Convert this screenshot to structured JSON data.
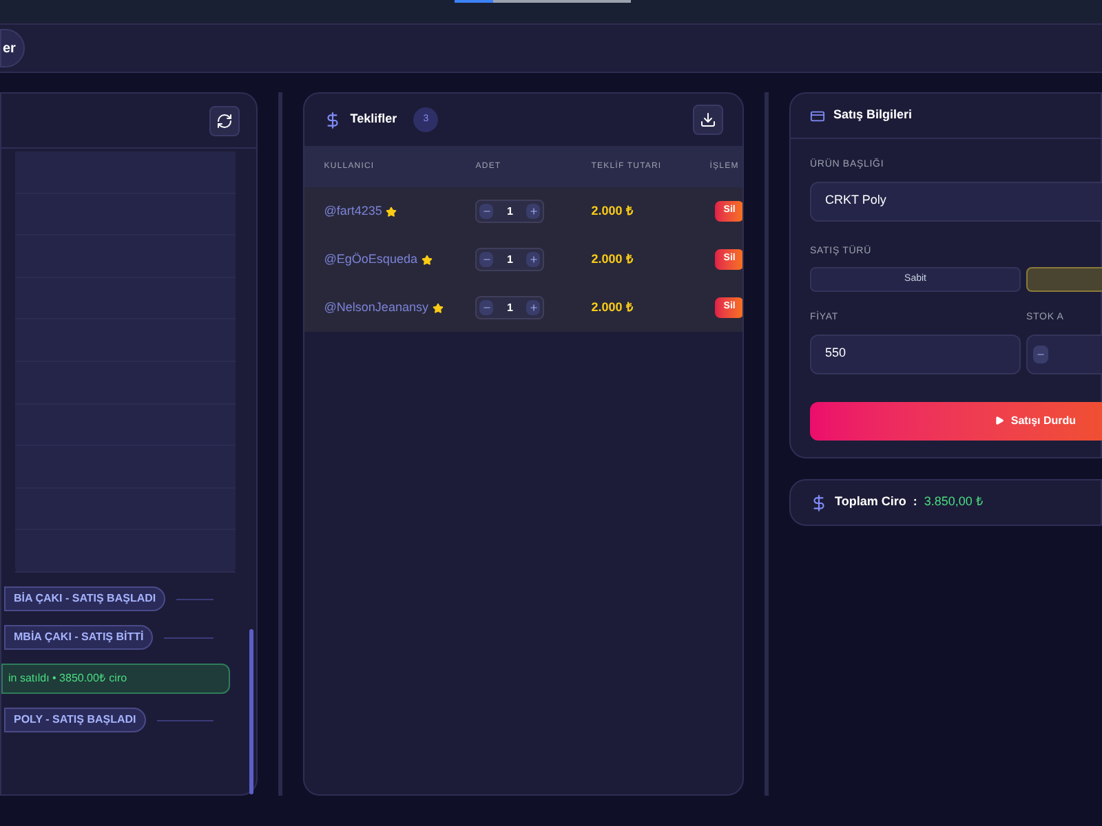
{
  "top_bar": {
    "chip": "er"
  },
  "chat_panel": {
    "events": [
      {
        "kind": "pill",
        "text": "BİA ÇAKI - SATIŞ BAŞLADI"
      },
      {
        "kind": "pill",
        "text": "MBİA ÇAKI - SATIŞ BİTTİ"
      },
      {
        "kind": "success",
        "text": "in satıldı • 3850.00₺ ciro"
      },
      {
        "kind": "pill",
        "text": "POLY - SATIŞ BAŞLADI"
      }
    ]
  },
  "offers": {
    "title": "Teklifler",
    "count": "3",
    "columns": [
      "KULLANICI",
      "ADET",
      "TEKLİF TUTARI",
      "İŞLEM"
    ],
    "rows": [
      {
        "user": "@fart4235",
        "quantity": "1",
        "amount": "2.000 ₺",
        "action": "Sil",
        "starred": true
      },
      {
        "user": "@EgÖoEsqueda",
        "quantity": "1",
        "amount": "2.000 ₺",
        "action": "Sil",
        "starred": true
      },
      {
        "user": "@NelsonJeanansy",
        "quantity": "1",
        "amount": "2.000 ₺",
        "action": "Sil",
        "starred": true
      }
    ]
  },
  "sale_info": {
    "title": "Satış Bilgileri",
    "product_label": "ÜRÜN BAŞLIĞI",
    "product_value": "CRKT Poly",
    "type_label": "SATIŞ TÜRÜ",
    "type_options": [
      {
        "label": "Sabit",
        "selected": false
      },
      {
        "selected": true
      }
    ],
    "price_label": "FİYAT",
    "price_value": "550",
    "stock_label": "STOK A",
    "stop_button": "Satışı Durdu"
  },
  "total": {
    "label": "Toplam Ciro",
    "separator": ":",
    "value": "3.850,00 ₺"
  }
}
